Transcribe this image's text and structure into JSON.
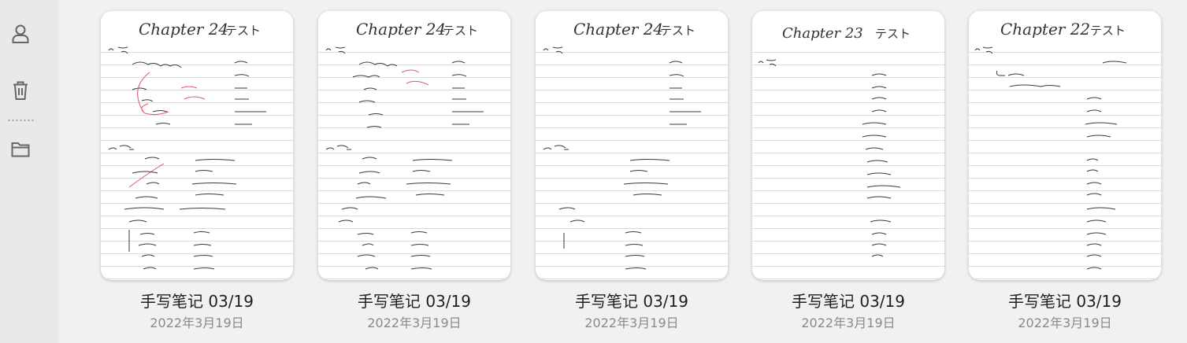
{
  "sidebar": {
    "icons": [
      {
        "name": "user-icon"
      },
      {
        "name": "trash-icon"
      },
      {
        "name": "folder-icon"
      }
    ]
  },
  "notes": [
    {
      "title": "手写笔记 03/19",
      "date": "2022年3月19日",
      "heading": "Chapter 24",
      "heading_right": "テスト"
    },
    {
      "title": "手写笔记 03/19",
      "date": "2022年3月19日",
      "heading": "Chapter 24",
      "heading_right": "テスト"
    },
    {
      "title": "手写笔记 03/19",
      "date": "2022年3月19日",
      "heading": "Chapter 24",
      "heading_right": "テスト"
    },
    {
      "title": "手写笔记 03/19",
      "date": "2022年3月19日",
      "heading": "Chapter 23",
      "heading_right": "テスト"
    },
    {
      "title": "手写笔记 03/19",
      "date": "2022年3月19日",
      "heading": "Chapter 22",
      "heading_right": "テスト"
    }
  ],
  "colors": {
    "ink": "#3a3a3a",
    "red_ink": "#d9586a",
    "sidebar_bg": "#e9e9e9",
    "main_bg": "#f1f1f1"
  }
}
